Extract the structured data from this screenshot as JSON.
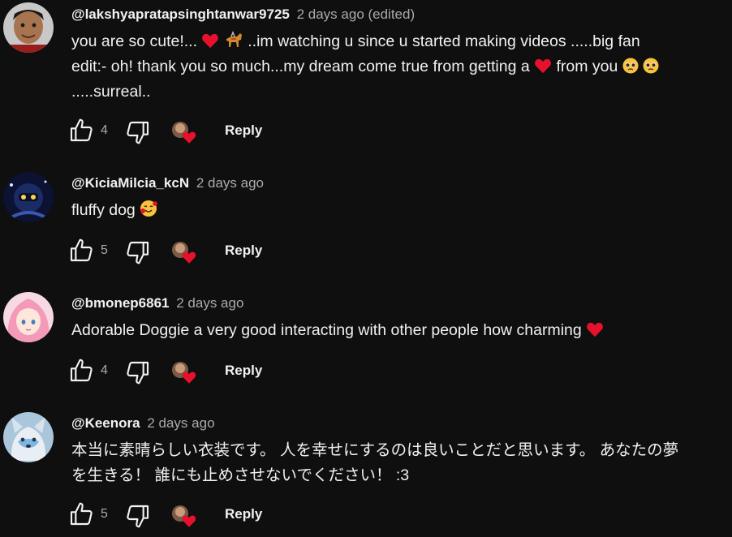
{
  "comments": [
    {
      "author": "@lakshyapratapsinghtanwar9725",
      "meta": "2 days ago (edited)",
      "lines": [
        [
          "you are so cute!... ",
          "..im watching u since u started making videos .....big fan"
        ],
        [
          "edit:- oh! thank you so much...my dream come true from getting a ",
          "  from you",
          " "
        ],
        [
          ".....surreal.."
        ]
      ],
      "likes": "4",
      "reply_label": "Reply"
    },
    {
      "author": "@KiciaMilcia_kcN",
      "meta": "2 days ago",
      "lines": [
        [
          "fluffy dog "
        ]
      ],
      "likes": "5",
      "reply_label": "Reply"
    },
    {
      "author": "@bmonep6861",
      "meta": "2 days ago",
      "lines": [
        [
          "Adorable Doggie a very good interacting with other people how charming "
        ]
      ],
      "likes": "4",
      "reply_label": "Reply"
    },
    {
      "author": "@Keenora",
      "meta": "2 days ago",
      "lines": [
        [
          "本当に素晴らしい衣装です。 人を幸せにするのは良いことだと思います。 あなたの夢"
        ],
        [
          "を生きる！ 誰にも止めさせないでください！ :3"
        ]
      ],
      "likes": "5",
      "reply_label": "Reply"
    }
  ],
  "icons": {
    "like": "thumb-up-icon",
    "dislike": "thumb-down-icon",
    "creator_heart": "creator-heart-icon",
    "heart_emoji": "red-heart-emoji",
    "dog_emoji": "guide-dog-emoji",
    "pleading_emoji": "pleading-face-emoji",
    "smiling_hearts_emoji": "smiling-face-with-hearts-emoji"
  },
  "colors": {
    "background": "#0f0f0f",
    "text": "#f1f1f1",
    "secondary_text": "#aaaaaa",
    "heart": "#e8112d"
  }
}
